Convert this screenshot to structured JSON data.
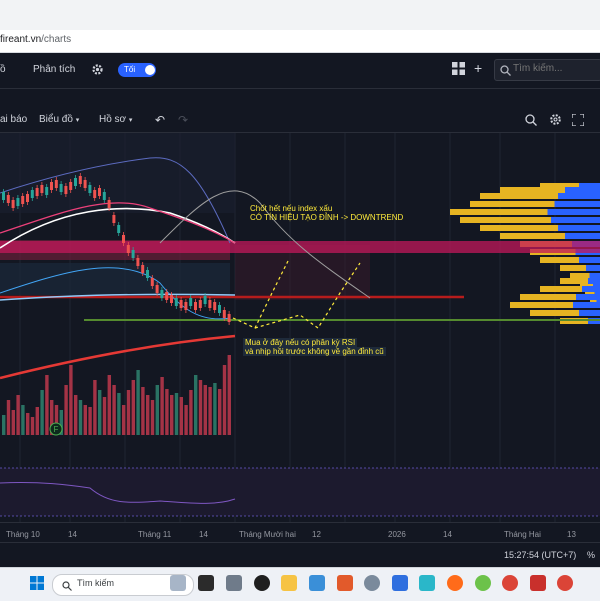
{
  "browser": {
    "url_host": "fireant.vn",
    "url_path": "/charts"
  },
  "header": {
    "left_cut_label": "ồ",
    "analysis_tab": "Phân tích",
    "theme_toggle_label": "Tối",
    "search_placeholder": "Tìm kiếm..."
  },
  "toolbar": {
    "alerts_label": "ai báo",
    "chart_type_label": "Biểu đồ",
    "profile_label": "Hồ sơ"
  },
  "annotations": {
    "top_line1": "Chốt hết nếu index xấu",
    "top_line2": "CÓ TÍN HIỆU TẠO ĐỈNH -> DOWNTREND",
    "bottom_line1": "Mua ở đây nếu có phân kỳ RSI",
    "bottom_line2": "và nhịp hồi trước không về gần đỉnh cũ"
  },
  "chart_marker": "F",
  "time_axis": [
    "Tháng 10",
    "14",
    "Tháng 11",
    "14",
    "Tháng Mười hai",
    "12",
    "2026",
    "14",
    "Tháng Hai",
    "13"
  ],
  "status": {
    "clock": "15:27:54 (UTC+7)",
    "percent": "%"
  },
  "taskbar": {
    "search_label": "Tìm kiếm"
  },
  "colors": {
    "accent": "#2962ff",
    "up": "#26a69a",
    "down": "#ef5350",
    "annotation": "#ffeb3b",
    "volume_profile_yellow": "#e6b422",
    "volume_profile_blue": "#2962ff"
  }
}
